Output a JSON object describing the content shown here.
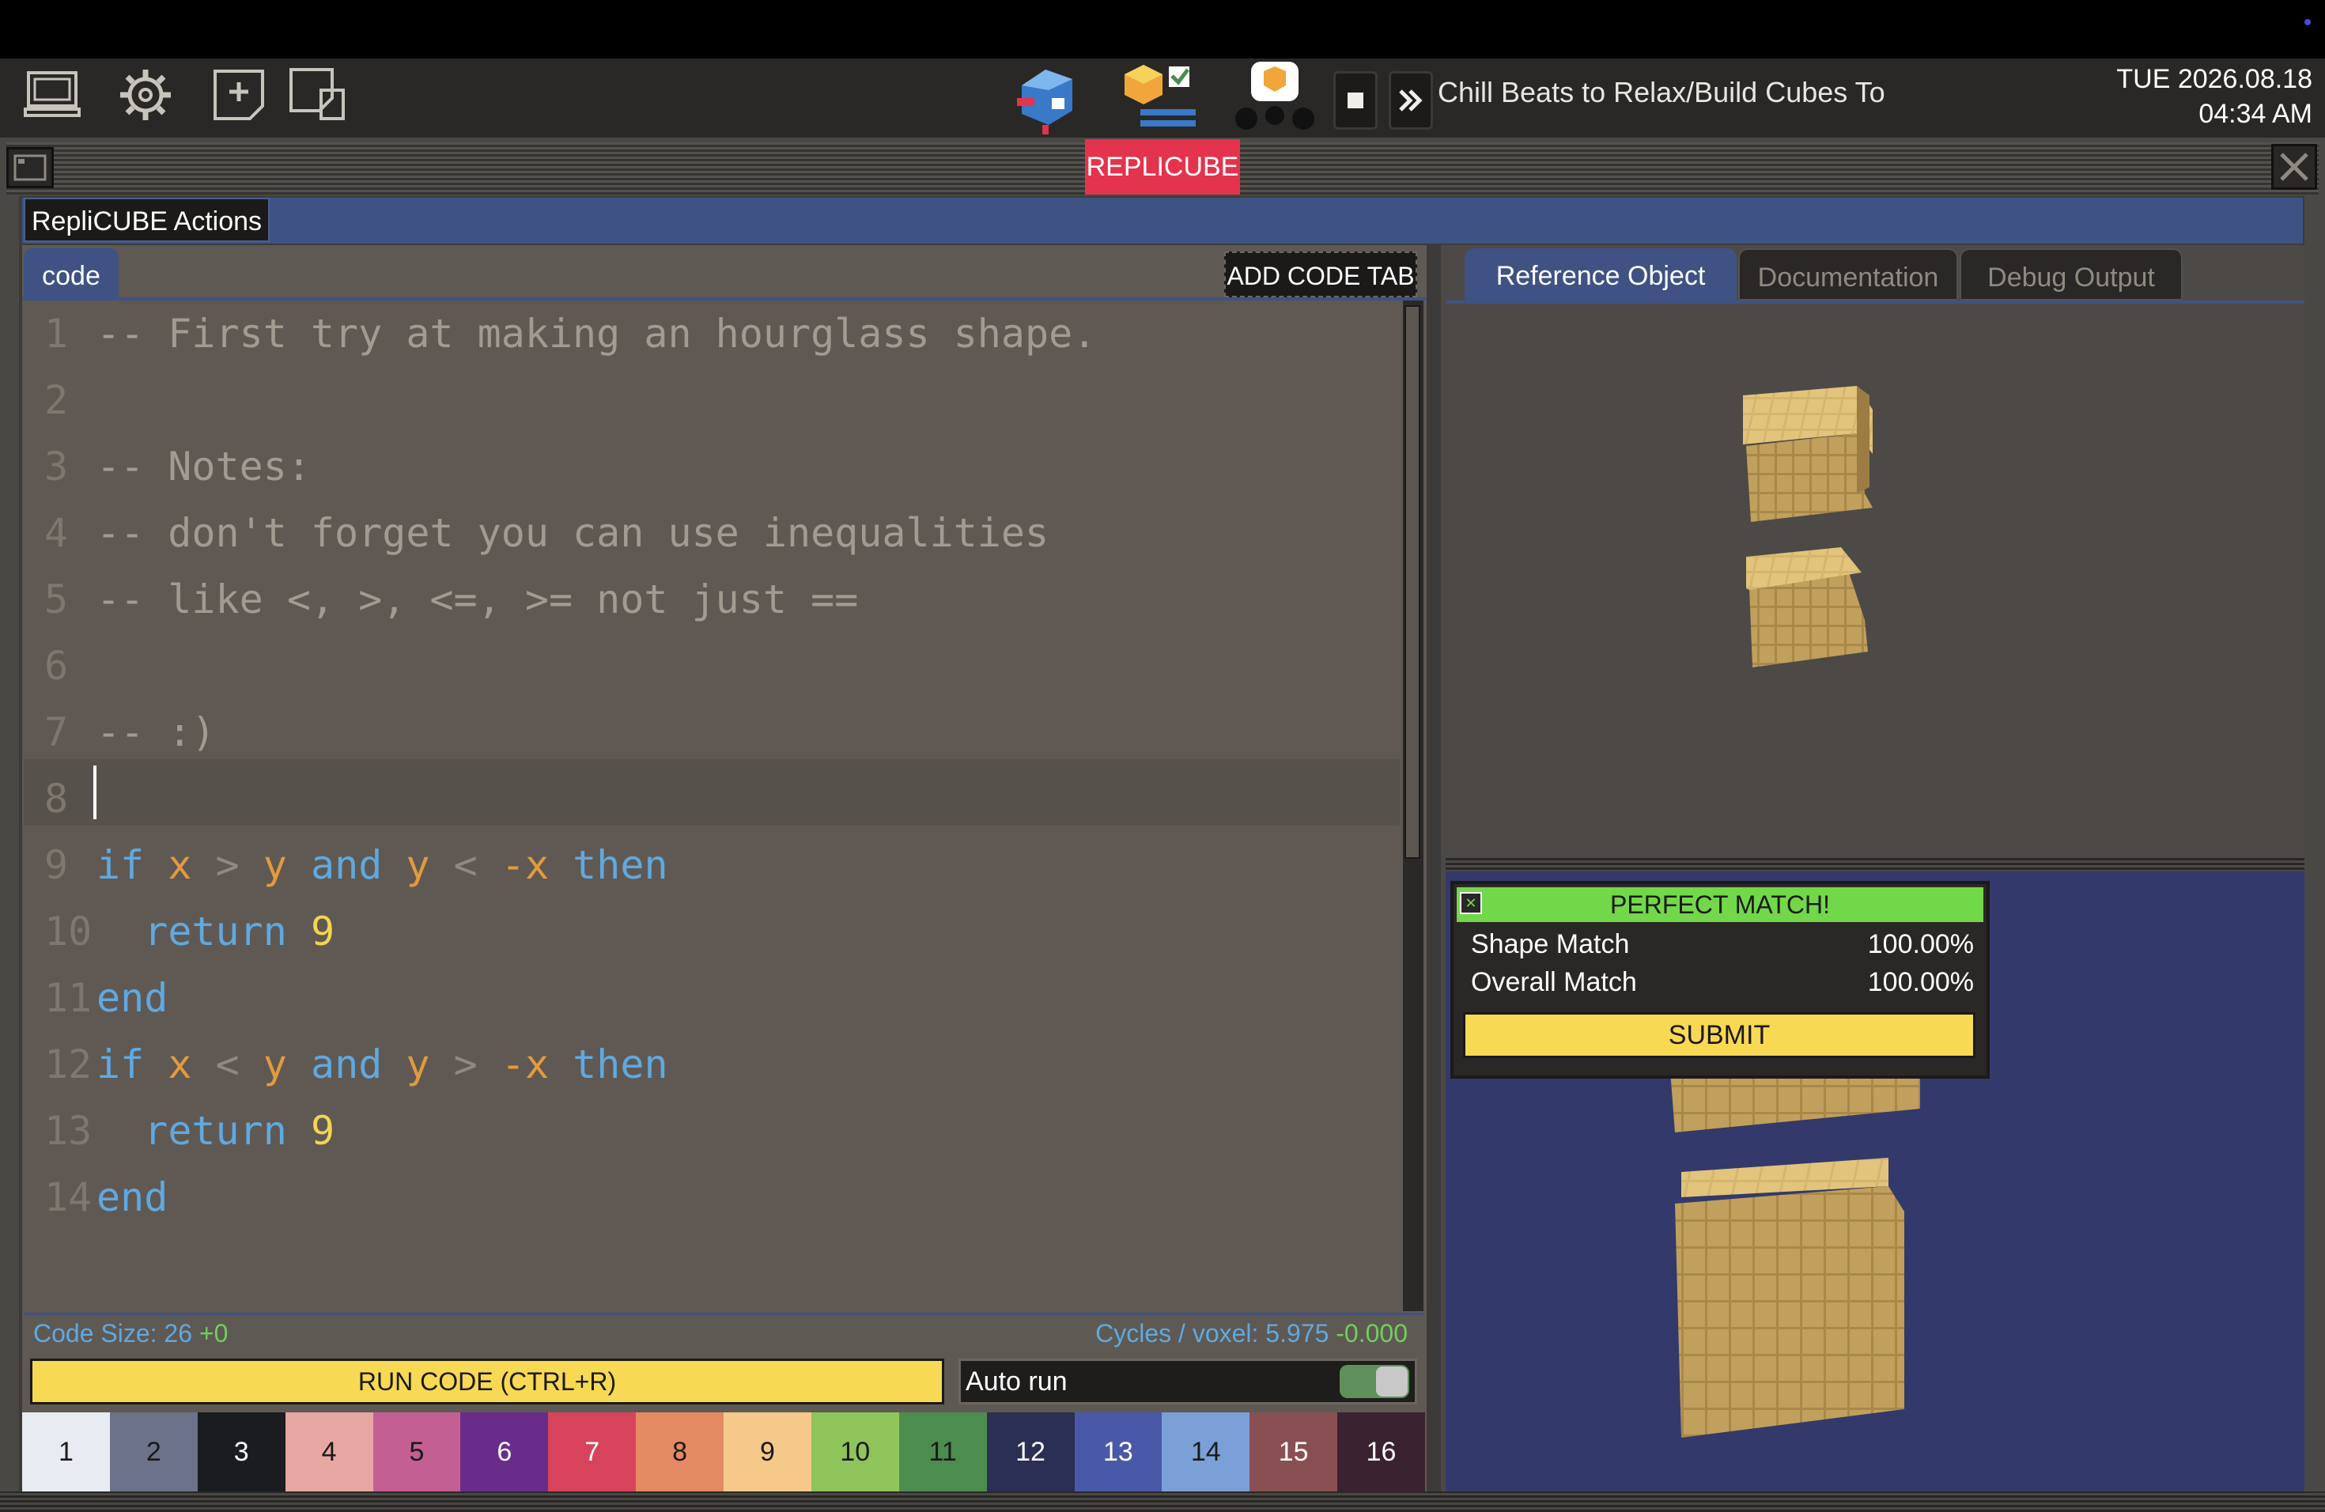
{
  "taskbar": {
    "now_playing": "Chill Beats to Relax/Build Cubes To",
    "date": "TUE 2026.08.18",
    "time": "04:34 AM"
  },
  "window": {
    "title": "REPLICUBE",
    "actions_menu": "RepliCUBE Actions"
  },
  "editor": {
    "tab_label": "code",
    "add_tab_label": "ADD CODE TAB",
    "lines": [
      {
        "n": "1",
        "text": "-- First try at making an hourglass shape."
      },
      {
        "n": "2",
        "text": ""
      },
      {
        "n": "3",
        "text": "-- Notes:"
      },
      {
        "n": "4",
        "text": "-- don't forget you can use inequalities"
      },
      {
        "n": "5",
        "text": "-- like <, >, <=, >= not just =="
      },
      {
        "n": "6",
        "text": ""
      },
      {
        "n": "7",
        "text": "-- :)"
      },
      {
        "n": "8",
        "text": ""
      },
      {
        "n": "9",
        "text": "if x > y and y < -x then"
      },
      {
        "n": "10",
        "text": "  return 9"
      },
      {
        "n": "11",
        "text": "end"
      },
      {
        "n": "12",
        "text": "if x < y and y > -x then"
      },
      {
        "n": "13",
        "text": "  return 9"
      },
      {
        "n": "14",
        "text": "end"
      }
    ],
    "code_size_label": "Code Size: 26",
    "code_size_delta": "+0",
    "cycles_label": "Cycles / voxel: 5.975",
    "cycles_delta": "-0.000",
    "run_label": "RUN CODE (CTRL+R)",
    "autorun_label": "Auto run",
    "autorun_on": true
  },
  "palette": [
    {
      "n": "1",
      "color": "#e8ecf2",
      "text": "#1b1a19"
    },
    {
      "n": "2",
      "color": "#6b7289",
      "text": "#1b1a19"
    },
    {
      "n": "3",
      "color": "#1a1c20",
      "text": "#ffffff"
    },
    {
      "n": "4",
      "color": "#e8a6a3",
      "text": "#1b1a19"
    },
    {
      "n": "5",
      "color": "#c45f94",
      "text": "#1b1a19"
    },
    {
      "n": "6",
      "color": "#6a2c8a",
      "text": "#ffffff"
    },
    {
      "n": "7",
      "color": "#d8435c",
      "text": "#ffffff"
    },
    {
      "n": "8",
      "color": "#e38a63",
      "text": "#1b1a19"
    },
    {
      "n": "9",
      "color": "#f4c98a",
      "text": "#1b1a19"
    },
    {
      "n": "10",
      "color": "#8fc45a",
      "text": "#1b1a19"
    },
    {
      "n": "11",
      "color": "#4d8c4f",
      "text": "#1b1a19"
    },
    {
      "n": "12",
      "color": "#2b2f55",
      "text": "#ffffff"
    },
    {
      "n": "13",
      "color": "#4a58a8",
      "text": "#ffffff"
    },
    {
      "n": "14",
      "color": "#7ba0d8",
      "text": "#1b1a19"
    },
    {
      "n": "15",
      "color": "#8a4f52",
      "text": "#ffffff"
    },
    {
      "n": "16",
      "color": "#3a2230",
      "text": "#ffffff"
    }
  ],
  "right": {
    "tabs": [
      "Reference Object",
      "Documentation",
      "Debug Output"
    ],
    "result_title": "PERFECT MATCH!",
    "shape_match_label": "Shape Match",
    "shape_match_value": "100.00%",
    "overall_match_label": "Overall Match",
    "overall_match_value": "100.00%",
    "submit_label": "SUBMIT"
  },
  "colors": {
    "accent_red": "#e4334c",
    "accent_yellow": "#f7d954",
    "match_green": "#72d84a",
    "cube_gold": "#c9a75c"
  }
}
